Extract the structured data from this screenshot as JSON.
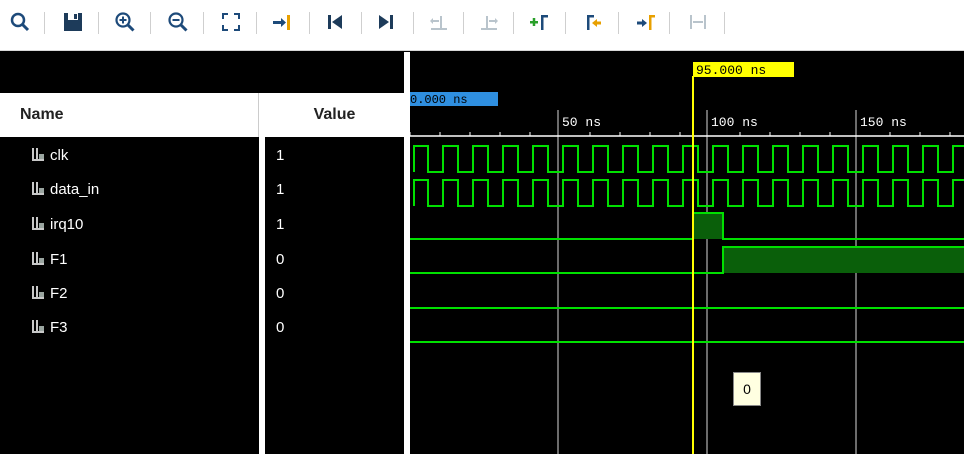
{
  "toolbar": {
    "buttons": [
      {
        "name": "search-icon"
      },
      {
        "name": "save-icon"
      },
      {
        "name": "zoom-in-icon"
      },
      {
        "name": "zoom-out-icon"
      },
      {
        "name": "zoom-fit-icon"
      },
      {
        "name": "go-to-cursor-icon"
      },
      {
        "name": "go-to-time-0-icon"
      },
      {
        "name": "go-to-last-time-icon"
      },
      {
        "name": "previous-transition-icon"
      },
      {
        "name": "next-transition-icon"
      },
      {
        "name": "add-marker-icon"
      },
      {
        "name": "previous-marker-icon"
      },
      {
        "name": "next-marker-icon"
      },
      {
        "name": "swap-cursors-icon"
      }
    ]
  },
  "columns": {
    "name": "Name",
    "value": "Value"
  },
  "signals": [
    {
      "name": "clk",
      "value": "1"
    },
    {
      "name": "data_in",
      "value": "1"
    },
    {
      "name": "irq10",
      "value": "1"
    },
    {
      "name": "F1",
      "value": "0"
    },
    {
      "name": "F2",
      "value": "0"
    },
    {
      "name": "F3",
      "value": "0"
    }
  ],
  "waveform": {
    "cursor_label": "95.000 ns",
    "marker_label": "0.000 ns",
    "time_labels": [
      "50 ns",
      "100 ns",
      "150 ns"
    ],
    "tooltip_value": "0",
    "colors": {
      "wave": "#00e000",
      "cursor": "#ffff00",
      "marker": "#2f8fe0",
      "fill": "#0a5f0a"
    }
  }
}
